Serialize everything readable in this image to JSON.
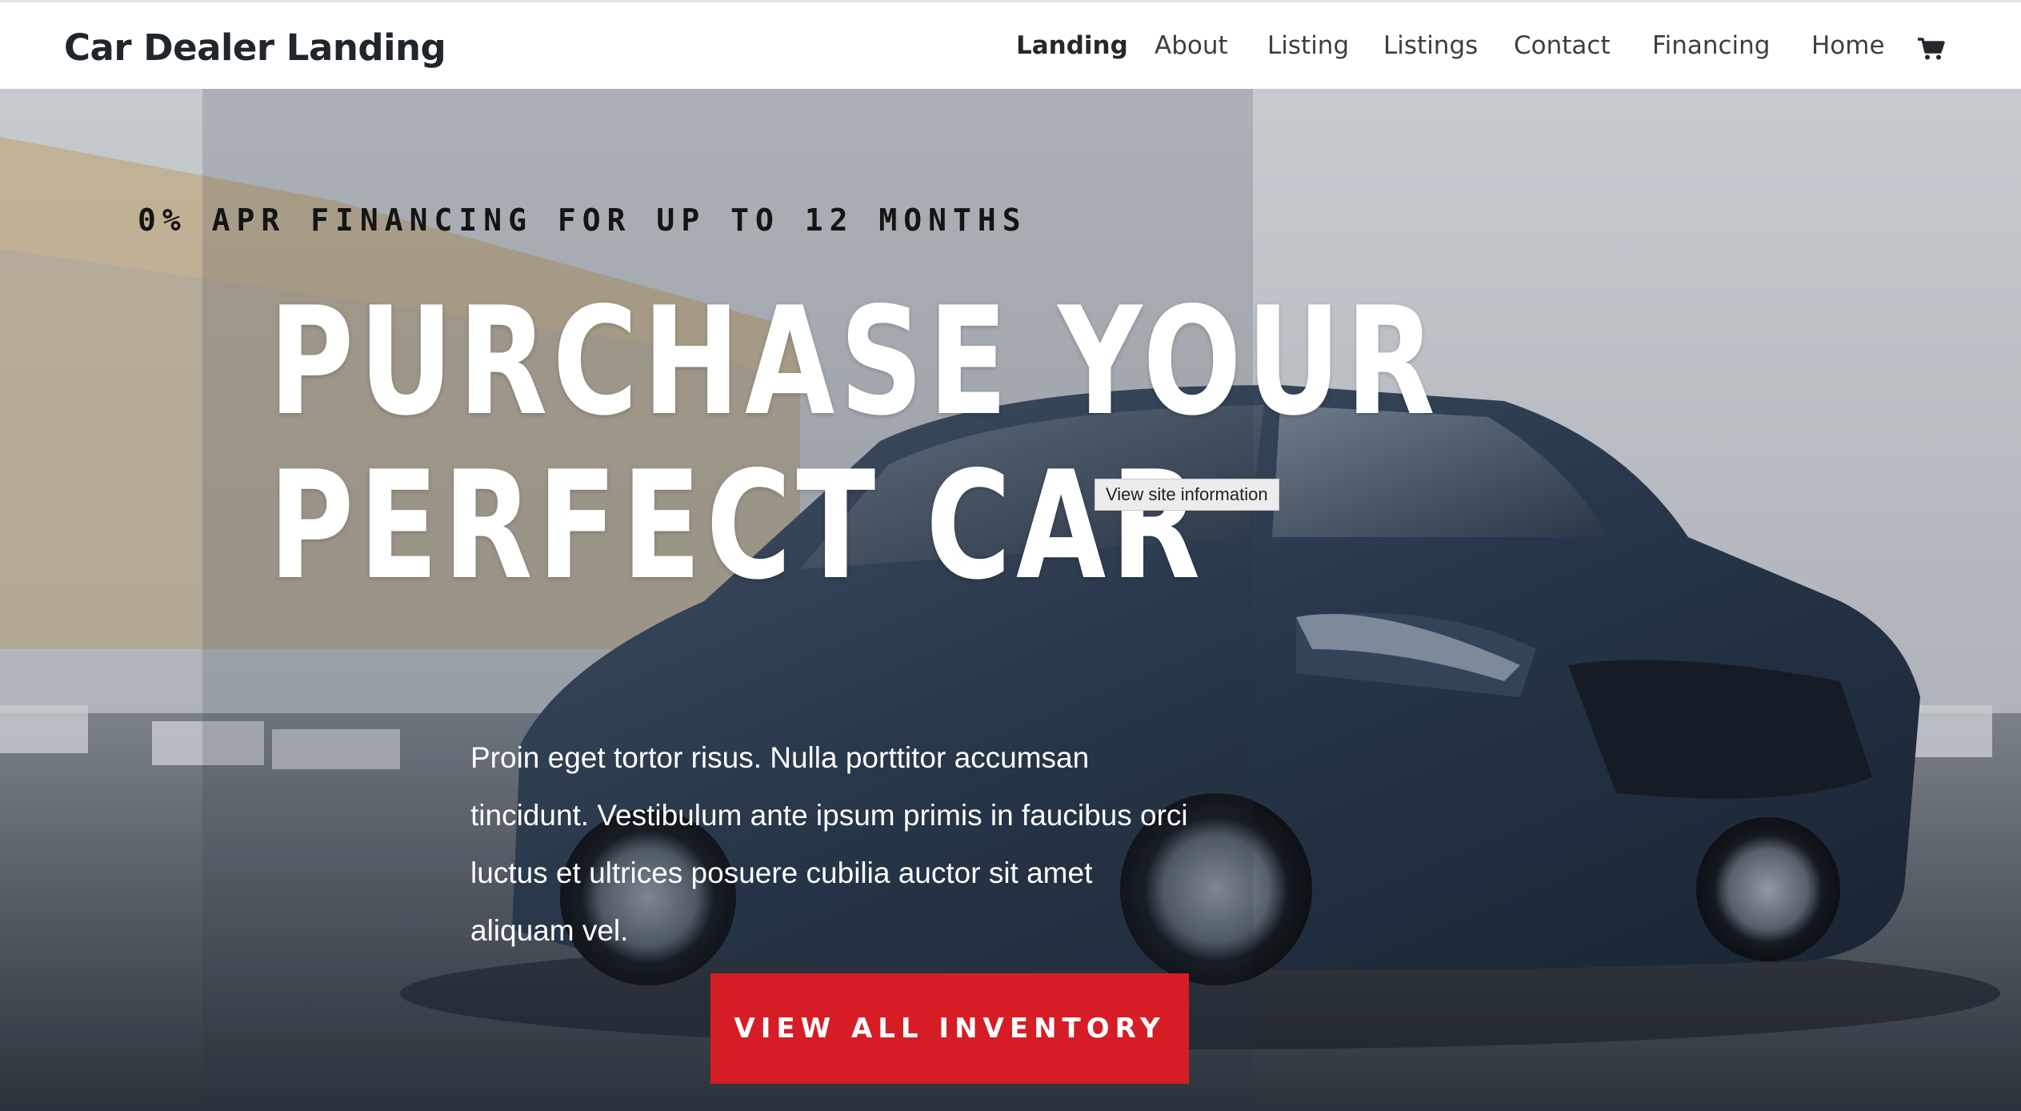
{
  "header": {
    "site_title": "Car Dealer Landing",
    "nav": [
      {
        "label": "Landing",
        "active": true
      },
      {
        "label": "About",
        "active": false
      },
      {
        "label": "Listing",
        "active": false
      },
      {
        "label": "Listings",
        "active": false
      },
      {
        "label": "Contact",
        "active": false
      },
      {
        "label": "Financing",
        "active": false
      },
      {
        "label": "Home",
        "active": false
      }
    ],
    "cart_icon": "shopping-cart-icon"
  },
  "hero": {
    "kicker": "0% APR FINANCING FOR UP TO 12 MONTHS",
    "headline_line1": "PURCHASE YOUR",
    "headline_line2": "PERFECT CAR",
    "body": "Proin eget tortor risus. Nulla porttitor accumsan tincidunt. Vestibulum ante ipsum primis in faucibus orci luctus et ultrices posuere cubilia auctor sit amet aliquam vel.",
    "cta_label": "VIEW ALL INVENTORY",
    "tooltip": "View site information",
    "background_image": "dark-blue-suv-photo"
  },
  "colors": {
    "cta_background": "#d61d26",
    "header_background": "#ffffff",
    "headline_text": "#ffffff",
    "kicker_text": "#141414"
  }
}
